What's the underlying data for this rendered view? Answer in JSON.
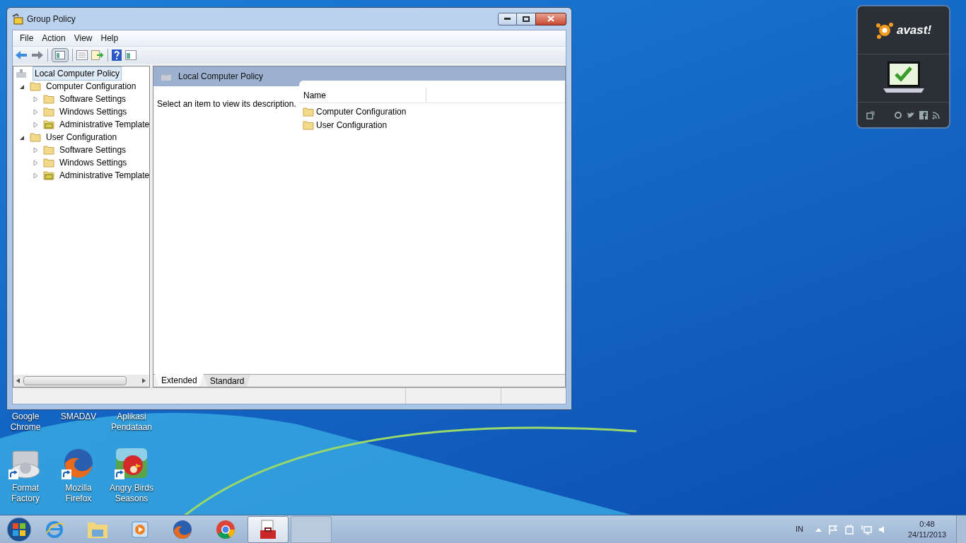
{
  "window": {
    "title": "Group Policy",
    "menu": [
      "File",
      "Action",
      "View",
      "Help"
    ],
    "tree": {
      "label": "Local Computer Policy",
      "selected": true,
      "children": [
        {
          "label": "Computer Configuration",
          "selected": false,
          "expanded": true,
          "children": [
            {
              "label": "Software Settings",
              "selected": false,
              "expanded": false
            },
            {
              "label": "Windows Settings",
              "selected": false,
              "expanded": false
            },
            {
              "label": "Administrative Template",
              "selected": false,
              "expanded": false,
              "kind": "template"
            }
          ]
        },
        {
          "label": "User Configuration",
          "selected": false,
          "expanded": true,
          "children": [
            {
              "label": "Software Settings",
              "selected": false,
              "expanded": false
            },
            {
              "label": "Windows Settings",
              "selected": false,
              "expanded": false
            },
            {
              "label": "Administrative Template",
              "selected": false,
              "expanded": false,
              "kind": "template"
            }
          ]
        }
      ]
    },
    "detail": {
      "title": "Local Computer Policy",
      "description": "Select an item to view its description.",
      "columns": [
        "Name"
      ],
      "rows": [
        "Computer Configuration",
        "User Configuration"
      ]
    },
    "tabs": [
      {
        "label": "Extended",
        "selected": true
      },
      {
        "label": "Standard",
        "selected": false
      }
    ]
  },
  "desktop_labels_covered": [
    "Google Chrome",
    "SMADΔV",
    "Aplikasi Pendataan"
  ],
  "desktop_icons": [
    "Format Factory",
    "Mozilla Firefox",
    "Angry Birds Seasons"
  ],
  "widget": {
    "logo": "avast!"
  },
  "taskbar": {
    "windows": [
      {
        "selected": true
      },
      {
        "selected": false
      }
    ],
    "tray": {
      "language": "IN",
      "time": "0:48",
      "date": "24/11/2013"
    }
  }
}
